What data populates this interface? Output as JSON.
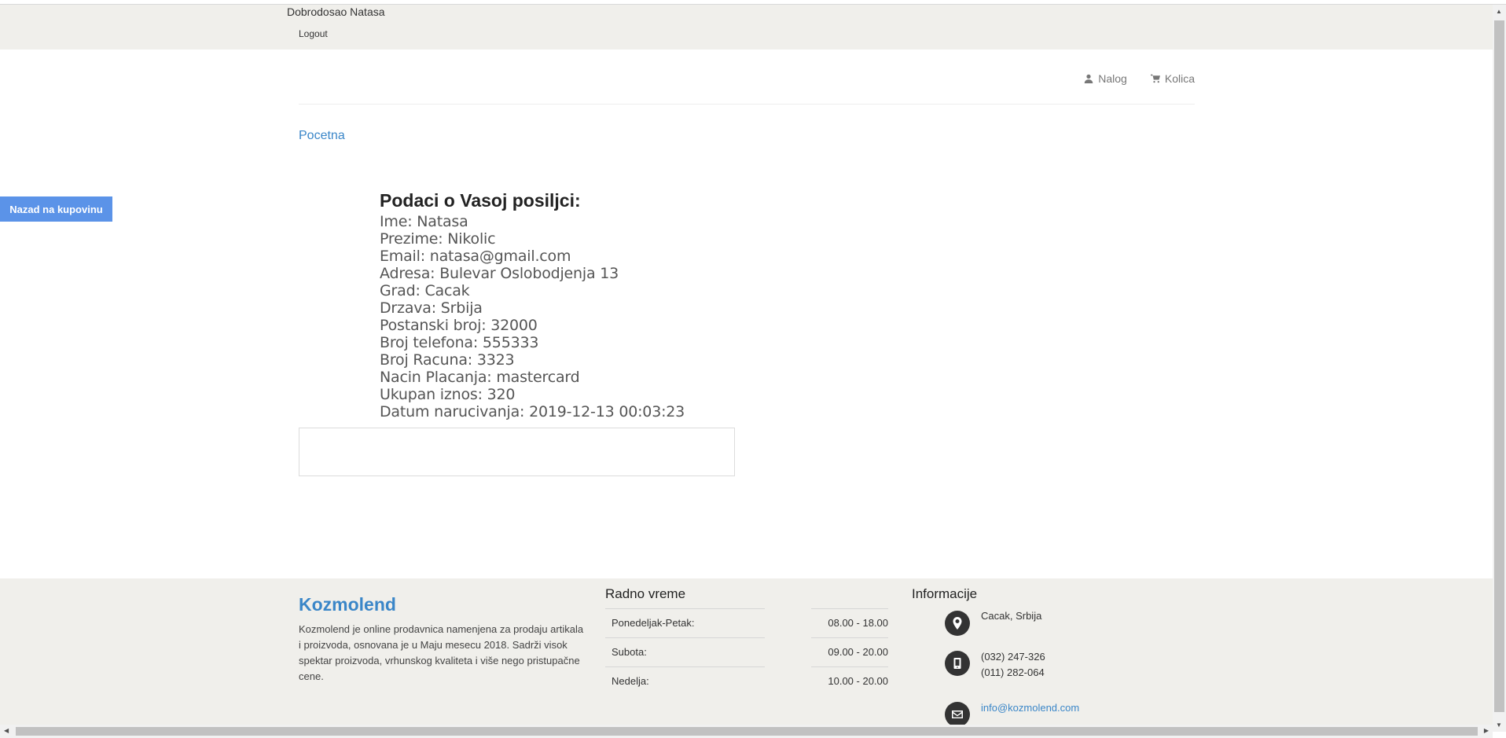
{
  "topbar": {
    "welcome": "Dobrodosao Natasa",
    "logout": "Logout"
  },
  "header": {
    "account_label": "Nalog",
    "cart_label": "Kolica"
  },
  "breadcrumb": {
    "home": "Pocetna"
  },
  "back_button": "Nazad na kupovinu",
  "order": {
    "title": "Podaci o Vasoj posiljci:",
    "rows": [
      "Ime: Natasa",
      "Prezime: Nikolic",
      "Email: natasa@gmail.com",
      "Adresa: Bulevar Oslobodjenja 13",
      "Grad: Cacak",
      "Drzava: Srbija",
      "Postanski broj: 32000",
      "Broj telefona: 555333",
      "Broj Racuna: 3323",
      "Nacin Placanja: mastercard",
      "Ukupan iznos: 320",
      "Datum narucivanja: 2019-12-13 00:03:23"
    ]
  },
  "footer": {
    "brand": "Kozmolend",
    "about": "Kozmolend je online prodavnica namenjena za prodaju artikala i proizvoda, osnovana je u Maju mesecu 2018. Sadrži visok spektar proizvoda, vrhunskog kvaliteta i više nego pristupačne cene.",
    "hours_title": "Radno vreme",
    "hours": [
      {
        "day": "Ponedeljak-Petak:",
        "time": "08.00 - 18.00"
      },
      {
        "day": "Subota:",
        "time": "09.00 - 20.00"
      },
      {
        "day": "Nedelja:",
        "time": "10.00 - 20.00"
      }
    ],
    "info_title": "Informacije",
    "location": "Cacak, Srbija",
    "phone1": "(032) 247-326",
    "phone2": "(011) 282-064",
    "email": "info@kozmolend.com"
  },
  "icons": {
    "account": "user-icon",
    "cart": "cart-icon",
    "location": "map-marker-icon",
    "phone": "mobile-phone-icon",
    "email": "envelope-icon"
  },
  "colors": {
    "accent": "#3a86c8",
    "button": "#5b93e8",
    "band": "#f0efeb"
  }
}
